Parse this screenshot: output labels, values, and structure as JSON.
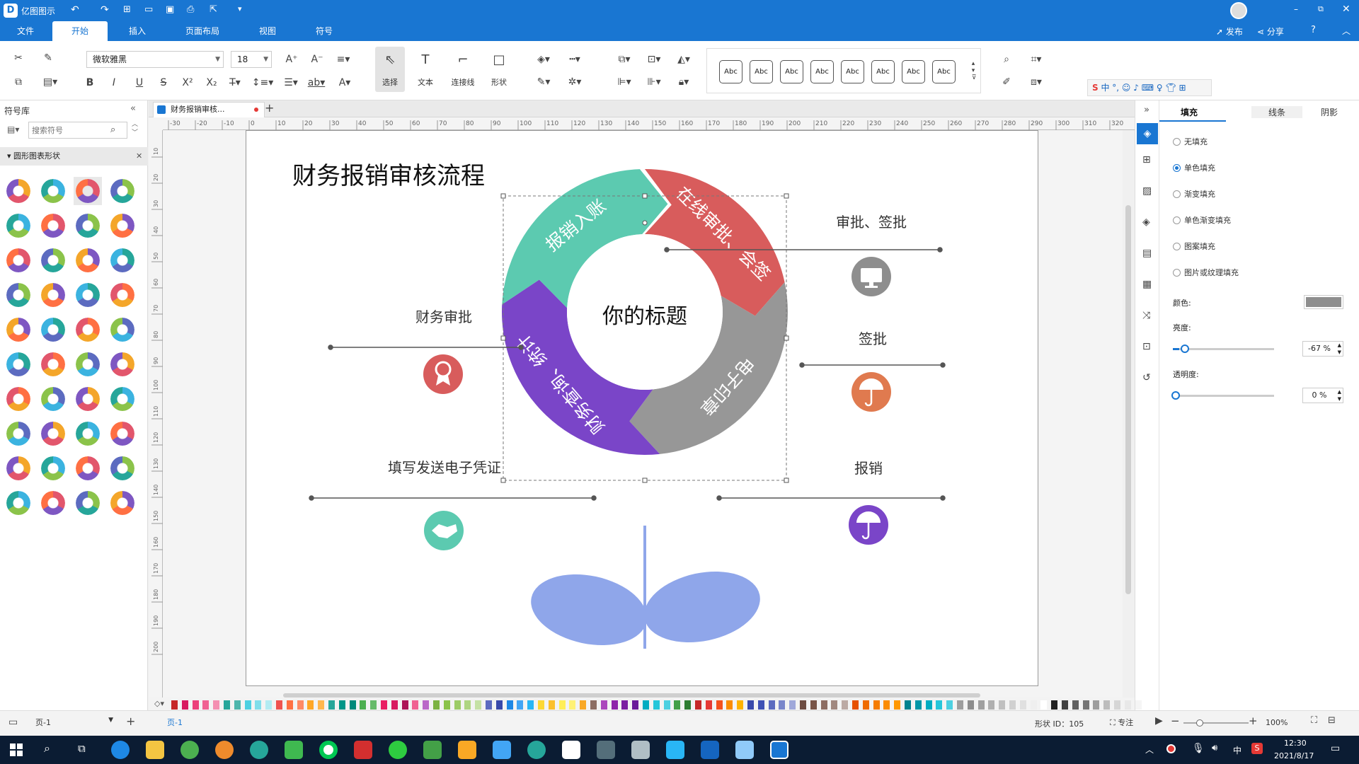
{
  "app": {
    "title": "亿图图示"
  },
  "menu": {
    "items": [
      "文件",
      "开始",
      "插入",
      "页面布局",
      "视图",
      "符号"
    ],
    "publish": "发布",
    "share": "分享"
  },
  "ribbon": {
    "font_name": "微软雅黑",
    "font_size": "18",
    "tools": [
      {
        "label": "选择"
      },
      {
        "label": "文本"
      },
      {
        "label": "连接线"
      },
      {
        "label": "形状"
      }
    ],
    "style_samples": [
      "Abc",
      "Abc",
      "Abc",
      "Abc",
      "Abc",
      "Abc",
      "Abc",
      "Abc"
    ]
  },
  "left_panel": {
    "title": "符号库",
    "search_placeholder": "搜索符号",
    "category": "圆形图表形状"
  },
  "document": {
    "tab_title": "财务报销审核..."
  },
  "ruler": {
    "top_labels": [
      "-30",
      "-20",
      "-10",
      "0",
      "10",
      "20",
      "30",
      "40",
      "50",
      "60",
      "70",
      "80",
      "90",
      "100",
      "110",
      "120",
      "130",
      "140",
      "150",
      "160",
      "170",
      "180",
      "190",
      "200",
      "210",
      "220",
      "230",
      "240",
      "250",
      "260",
      "270",
      "280",
      "290",
      "300",
      "310",
      "320"
    ],
    "left_labels": [
      "10",
      "20",
      "30",
      "40",
      "50",
      "60",
      "70",
      "80",
      "90",
      "100",
      "110",
      "120",
      "130",
      "140",
      "150",
      "160",
      "170",
      "180",
      "190",
      "200"
    ]
  },
  "diagram": {
    "page_title": "财务报销审核流程",
    "center_title": "你的标题",
    "segments": [
      {
        "text": "在线审批、会签",
        "color": "#d85c5c"
      },
      {
        "text": "电子印章",
        "color": "#979797"
      },
      {
        "text": "财务查询、统计",
        "color": "#7a45c8"
      },
      {
        "text": "报销入账",
        "color": "#5ccab0"
      }
    ],
    "callouts": [
      {
        "label": "财务审批",
        "icon": "award-icon",
        "color": "#d85c5c"
      },
      {
        "label": "审批、签批",
        "icon": "monitor-icon",
        "color": "#8e8e8e"
      },
      {
        "label": "签批",
        "icon": "umbrella-icon",
        "color": "#e07a4f"
      },
      {
        "label": "填写发送电子凭证",
        "icon": "handshake-icon",
        "color": "#5ccab0"
      },
      {
        "label": "报销",
        "icon": "umbrella-icon",
        "color": "#7a45c8"
      }
    ],
    "leaf_color": "#8fa6ea"
  },
  "right_panel": {
    "tabs": [
      "填充",
      "线条",
      "阴影"
    ],
    "fill_options": [
      "无填充",
      "单色填充",
      "渐变填充",
      "单色渐变填充",
      "图案填充",
      "图片或纹理填充"
    ],
    "selected_fill": "单色填充",
    "color_label": "颜色:",
    "color_value": "#8e8e8e",
    "brightness_label": "亮度:",
    "brightness_value": "-67 %",
    "brightness_fraction": 0.06,
    "opacity_label": "透明度:",
    "opacity_value": "0 %",
    "opacity_fraction": 0.0
  },
  "status": {
    "page_name": "页-1",
    "page_tab": "页-1",
    "shape_id": "形状 ID：105",
    "focus": "专注",
    "zoom": "100%"
  },
  "taskbar": {
    "time": "12:30",
    "date": "2021/8/17",
    "ime": "中"
  }
}
